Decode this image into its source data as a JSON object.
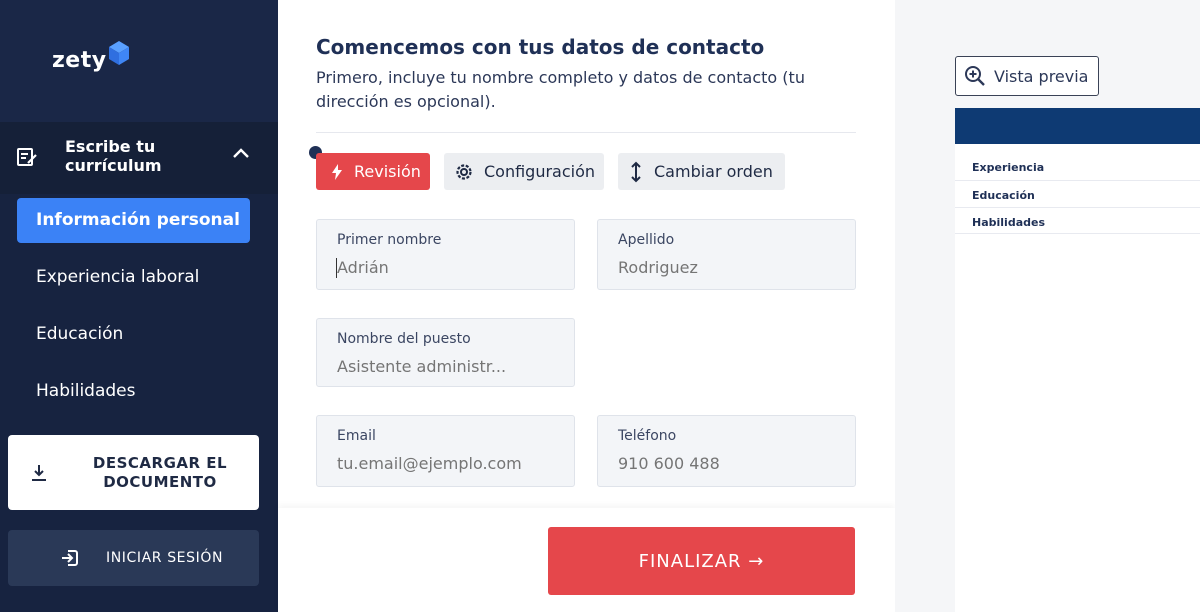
{
  "sidebar": {
    "logo": "zety",
    "section_title": "Escribe tu currículum",
    "items": [
      {
        "label": "Información personal",
        "active": true
      },
      {
        "label": "Experiencia laboral",
        "active": false
      },
      {
        "label": "Educación",
        "active": false
      },
      {
        "label": "Habilidades",
        "active": false
      }
    ],
    "download_label": "DESCARGAR EL DOCUMENTO",
    "login_label": "INICIAR SESIÓN"
  },
  "form": {
    "title": "Comencemos con tus datos de contacto",
    "subtitle": "Primero, incluye tu nombre completo y datos de contacto (tu dirección es opcional).",
    "toolbar": {
      "review_label": "Revisión",
      "settings_label": "Configuración",
      "reorder_label": "Cambiar orden"
    },
    "fields": {
      "first_name": {
        "label": "Primer nombre",
        "placeholder": "Adrián"
      },
      "last_name": {
        "label": "Apellido",
        "placeholder": "Rodriguez"
      },
      "job_title": {
        "label": "Nombre del puesto",
        "placeholder": "Asistente administr..."
      },
      "email": {
        "label": "Email",
        "placeholder": "tu.email@ejemplo.com"
      },
      "phone": {
        "label": "Teléfono",
        "placeholder": "910 600 488"
      }
    },
    "finish_label": "FINALIZAR →"
  },
  "preview": {
    "button_label": "Vista previa",
    "sections": [
      "Experiencia",
      "Educación",
      "Habilidades"
    ]
  },
  "colors": {
    "sidebar_bg": "#172340",
    "accent_blue": "#3b82f6",
    "accent_red": "#e5474b",
    "preview_header": "#0e3a73"
  }
}
